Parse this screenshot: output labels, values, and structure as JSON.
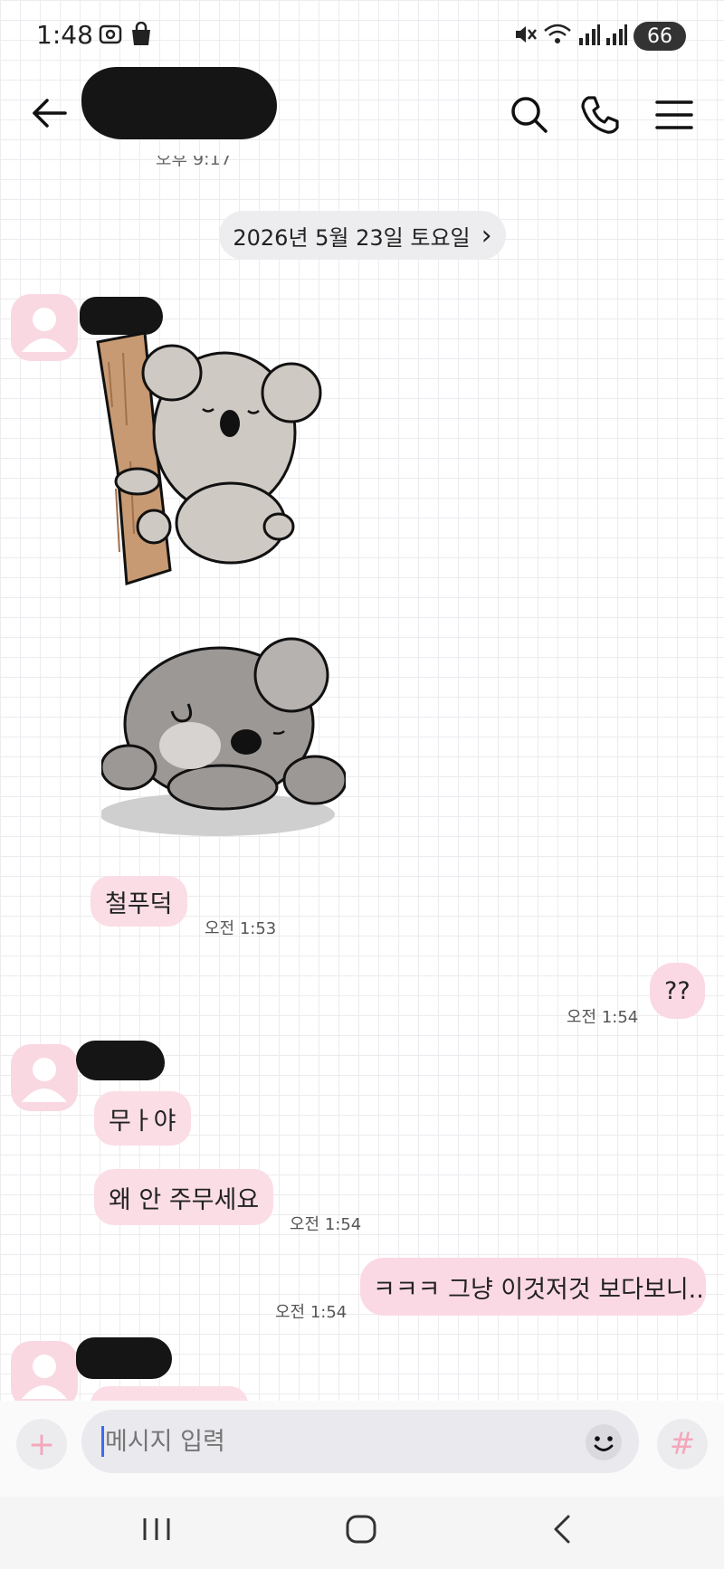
{
  "status_bar": {
    "time": "1:48",
    "battery": "66",
    "icons": [
      "photo-sync-icon",
      "shopping-bag-icon",
      "mute-icon",
      "wifi-icon",
      "signal-icon",
      "signal-icon-2"
    ]
  },
  "header": {
    "icons": [
      "back-arrow-icon",
      "search-icon",
      "phone-icon",
      "menu-icon"
    ]
  },
  "cut_time": "오후 9:17",
  "date_chip": {
    "label": "2026년 5월 23일 토요일",
    "chevron": "›"
  },
  "messages": {
    "m1_text": "철푸덕",
    "m1_time": "오전 1:53",
    "m2_text": "??",
    "m2_time": "오전 1:54",
    "m3_text": "무ㅏ야",
    "m4_text": "왜 안 주무세요",
    "m4_time": "오전 1:54",
    "m5_text": "ㅋㅋㅋ 그냥 이것저것 보다보니..",
    "m5_time": "오전 1:54"
  },
  "input": {
    "placeholder": "메시지 입력",
    "plus": "+",
    "hash": "#"
  },
  "colors": {
    "bubble_in": "#fbdde6",
    "bubble_out": "#fbd9e4",
    "avatar": "#f9d8e2",
    "accent_pink": "#f4a7bb"
  }
}
